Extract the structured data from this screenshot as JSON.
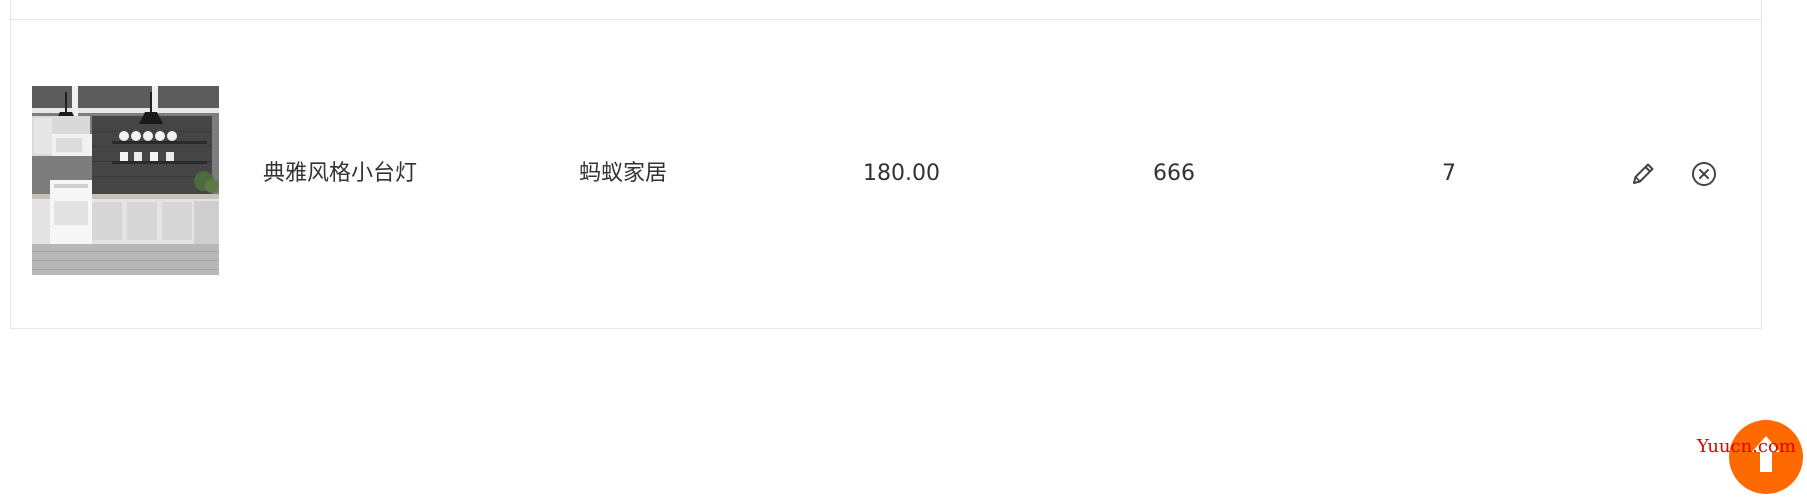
{
  "cart": {
    "items": [
      {
        "image_alt": "kitchen-interior-photo",
        "name": "典雅风格小台灯",
        "brand": "蚂蚁家居",
        "price": "180.00",
        "stock": "666",
        "quantity": "7"
      }
    ]
  },
  "actions": {
    "edit_icon": "pencil-icon",
    "delete_icon": "circle-x-icon"
  },
  "back_to_top": {
    "icon": "arrow-up-icon",
    "color": "#ff6a00"
  },
  "watermark": {
    "text": "Yuucn.com",
    "color": "#e00000"
  }
}
